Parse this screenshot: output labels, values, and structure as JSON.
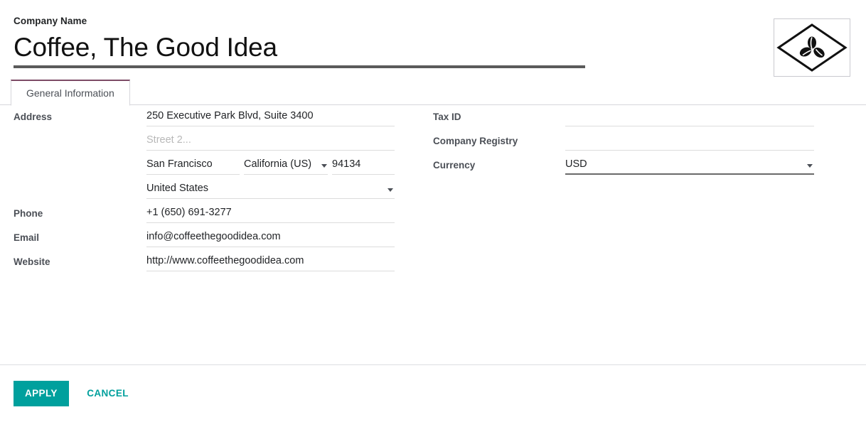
{
  "header": {
    "company_label": "Company Name",
    "company_name": "Coffee, The Good Idea",
    "logo_icon": "coffee-beans-diamond-logo"
  },
  "tabs": [
    {
      "label": "General Information",
      "active": true
    }
  ],
  "form": {
    "left": {
      "address_label": "Address",
      "street1_value": "250 Executive Park Blvd, Suite 3400",
      "street2_placeholder": "Street 2...",
      "city_value": "San Francisco",
      "state_value": "California (US)",
      "state_caret_icon": "chevron-down-icon",
      "zip_value": "94134",
      "country_value": "United States",
      "country_caret_icon": "chevron-down-icon",
      "phone_label": "Phone",
      "phone_value": "+1 (650) 691-3277",
      "email_label": "Email",
      "email_value": "info@coffeethegoodidea.com",
      "website_label": "Website",
      "website_value": "http://www.coffeethegoodidea.com"
    },
    "right": {
      "tax_id_label": "Tax ID",
      "tax_id_value": "",
      "company_registry_label": "Company Registry",
      "company_registry_value": "",
      "currency_label": "Currency",
      "currency_value": "USD",
      "currency_caret_icon": "chevron-down-icon"
    }
  },
  "footer": {
    "apply_label": "APPLY",
    "cancel_label": "CANCEL"
  },
  "colors": {
    "accent": "#00a09d",
    "tab_top_border": "#7d4b66",
    "title_underline": "#5a5a5a",
    "field_underline": "#dcdcdc",
    "field_underline_focused": "#6a6a6a"
  }
}
